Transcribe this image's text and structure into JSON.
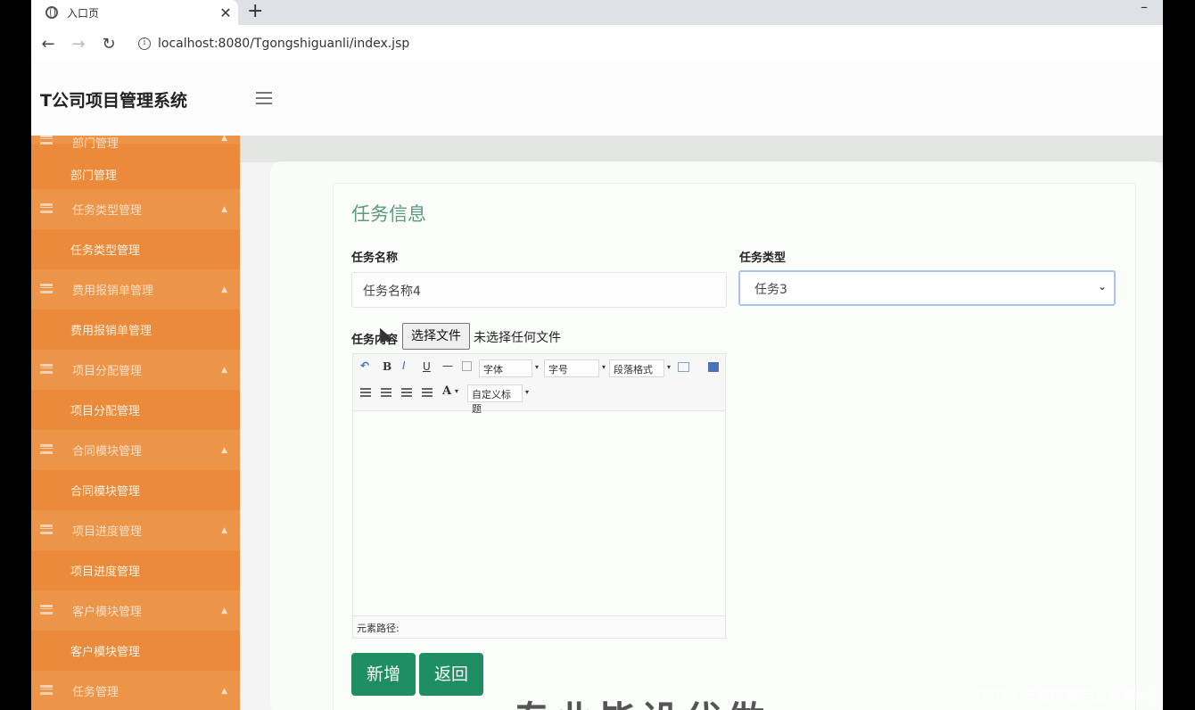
{
  "browser": {
    "tab_title": "入口页",
    "tab_close": "✕",
    "new_tab": "+",
    "minimize": "–",
    "back": "←",
    "forward": "→",
    "reload": "↻",
    "info": "i",
    "url": "localhost:8080/Tgongshiguanli/index.jsp"
  },
  "app": {
    "title": "T公司项目管理系统"
  },
  "sidebar": {
    "top_caret": "▲",
    "items": [
      {
        "group": "部门管理",
        "sub": "部门管理",
        "caret": "▲"
      },
      {
        "group": "任务类型管理",
        "sub": "任务类型管理",
        "caret": "▲"
      },
      {
        "group": "费用报销单管理",
        "sub": "费用报销单管理",
        "caret": "▲"
      },
      {
        "group": "项目分配管理",
        "sub": "项目分配管理",
        "caret": "▲"
      },
      {
        "group": "合同模块管理",
        "sub": "合同模块管理",
        "caret": "▲"
      },
      {
        "group": "项目进度管理",
        "sub": "项目进度管理",
        "caret": "▲"
      },
      {
        "group": "客户模块管理",
        "sub": "客户模块管理",
        "caret": "▲"
      },
      {
        "group": "任务管理",
        "caret": "▲"
      }
    ]
  },
  "form": {
    "section_title": "任务信息",
    "name_label": "任务名称",
    "name_value": "任务名称4",
    "type_label": "任务类型",
    "type_value": "任务3",
    "type_caret": "⌄",
    "content_label": "任务内容",
    "file_button": "选择文件",
    "file_status": "未选择任何文件",
    "editor": {
      "undo": "↶",
      "bold": "B",
      "italic": "I",
      "underline": "U",
      "hr": "—",
      "font_family": "字体",
      "font_size": "字号",
      "paragraph": "段落格式",
      "font_color": "A",
      "custom_title": "自定义标题",
      "dropdown_arrow": "▾",
      "path_label": "元素路径:"
    },
    "add_button": "新增",
    "back_button": "返回"
  },
  "overlay_text": "专业毕设代做",
  "watermark": "CSDN @程序猿毕业分享网"
}
